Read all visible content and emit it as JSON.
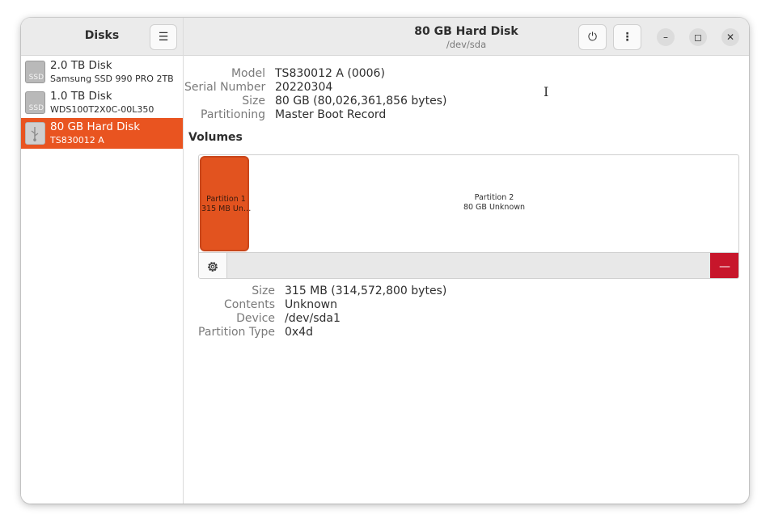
{
  "sidebar": {
    "title": "Disks",
    "disks": [
      {
        "name": "2.0 TB Disk",
        "sub": "Samsung SSD 990 PRO 2TB",
        "icon_text": "SSD"
      },
      {
        "name": "1.0 TB Disk",
        "sub": "WDS100T2X0C-00L350",
        "icon_text": "SSD"
      },
      {
        "name": "80 GB Hard Disk",
        "sub": "TS830012 A",
        "icon_text": "⚲"
      }
    ]
  },
  "header": {
    "title": "80 GB Hard Disk",
    "subtitle": "/dev/sda",
    "menu_icon": "☰",
    "power_icon": "⏻",
    "kebab_icon": "⋮",
    "min_icon": "–",
    "max_icon": "◻",
    "close_icon": "✕"
  },
  "disk_info": {
    "model_label": "Model",
    "model_value": "TS830012 A (0006)",
    "serial_label": "Serial Number",
    "serial_value": "20220304",
    "size_label": "Size",
    "size_value": "80 GB (80,026,361,856 bytes)",
    "partitioning_label": "Partitioning",
    "partitioning_value": "Master Boot Record"
  },
  "volumes": {
    "heading": "Volumes",
    "partition1": {
      "line1": "Partition 1",
      "line2": "315 MB Un…"
    },
    "partition2": {
      "line1": "Partition 2",
      "line2": "80 GB Unknown"
    },
    "minus_icon": "—"
  },
  "partition_info": {
    "size_label": "Size",
    "size_value": "315 MB (314,572,800 bytes)",
    "contents_label": "Contents",
    "contents_value": "Unknown",
    "device_label": "Device",
    "device_value": "/dev/sda1",
    "type_label": "Partition Type",
    "type_value": "0x4d"
  },
  "colors": {
    "accent": "#e95420",
    "danger": "#c7162b"
  }
}
